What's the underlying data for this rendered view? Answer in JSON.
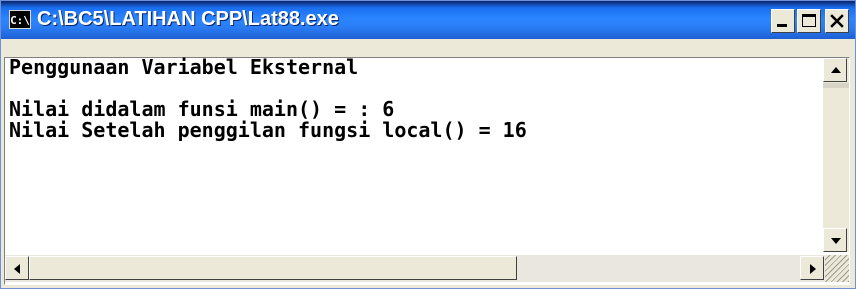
{
  "window": {
    "icon_text": "C:\\",
    "title": "C:\\BC5\\LATIHAN CPP\\Lat88.exe"
  },
  "console": {
    "lines": [
      "Penggunaan Variabel Eksternal",
      "",
      "Nilai didalam funsi main() = : 6",
      "Nilai Setelah penggilan fungsi local() = 16"
    ]
  },
  "colors": {
    "title_bar": "#2b86ff",
    "console_background": "#ffffff",
    "console_text": "#000000"
  },
  "icons": {
    "app": "console-app-icon",
    "minimize": "minimize-icon",
    "maximize": "maximize-icon",
    "close": "close-icon"
  }
}
